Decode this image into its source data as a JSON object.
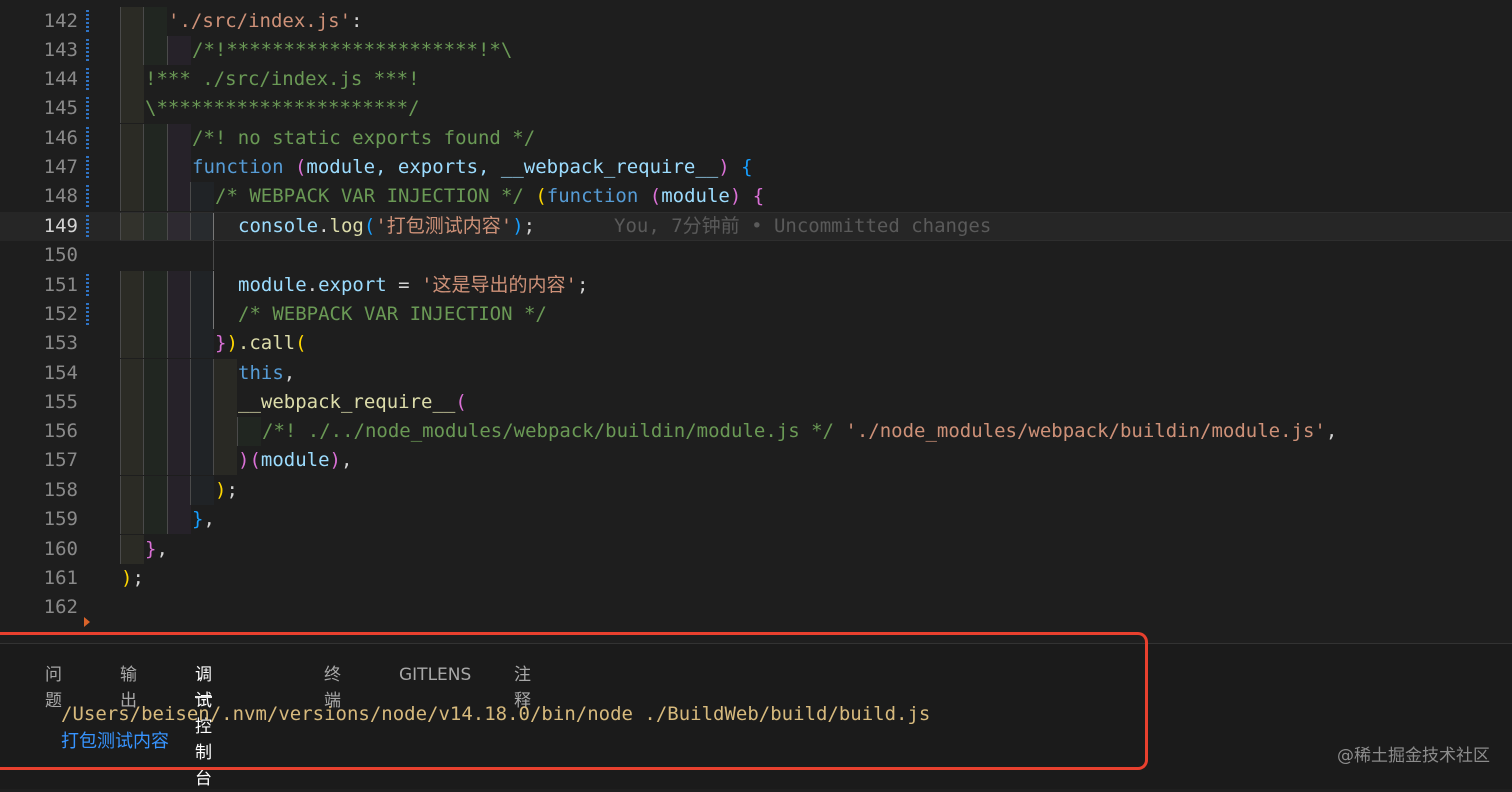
{
  "editor": {
    "lines": [
      {
        "n": "142"
      },
      {
        "n": "143"
      },
      {
        "n": "144"
      },
      {
        "n": "145"
      },
      {
        "n": "146"
      },
      {
        "n": "147"
      },
      {
        "n": "148"
      },
      {
        "n": "149"
      },
      {
        "n": "150"
      },
      {
        "n": "151"
      },
      {
        "n": "152"
      },
      {
        "n": "153"
      },
      {
        "n": "154"
      },
      {
        "n": "155"
      },
      {
        "n": "156"
      },
      {
        "n": "157"
      },
      {
        "n": "158"
      },
      {
        "n": "159"
      },
      {
        "n": "160"
      },
      {
        "n": "161"
      },
      {
        "n": "162"
      }
    ],
    "code": {
      "l142_str": "'./src/index.js'",
      "l142_colon": ":",
      "l143_comment": "/*!**********************!*\\",
      "l144_comment": "!*** ./src/index.js ***!",
      "l145_comment": "\\**********************/",
      "l146_comment": "/*! no static exports found */",
      "l147_function": "function",
      "l147_open": "(",
      "l147_params": "module, exports, __webpack_require__",
      "l147_close": ")",
      "l147_brace": "{",
      "l148_comment": "/* WEBPACK VAR INJECTION */",
      "l148_open": "(",
      "l148_function": "function",
      "l148_popen": "(",
      "l148_param": "module",
      "l148_pclose": ")",
      "l148_brace": "{",
      "l149_obj": "console",
      "l149_dot": ".",
      "l149_fn": "log",
      "l149_open": "(",
      "l149_str": "'打包测试内容'",
      "l149_close": ")",
      "l149_semi": ";",
      "l149_blame": "You, 7分钟前 • Uncommitted changes",
      "l151_obj": "module",
      "l151_dot": ".",
      "l151_prop": "export",
      "l151_eq": " = ",
      "l151_str": "'这是导出的内容'",
      "l151_semi": ";",
      "l152_comment": "/* WEBPACK VAR INJECTION */",
      "l153_brace": "}",
      "l153_paren": ")",
      "l153_call": ".call",
      "l153_open": "(",
      "l154_this": "this",
      "l154_comma": ",",
      "l155_fn": "__webpack_require__",
      "l155_open": "(",
      "l156_comment": "/*! ./../node_modules/webpack/buildin/module.js */",
      "l156_str": "'./node_modules/webpack/buildin/module.js'",
      "l156_comma": ",",
      "l157_close": ")",
      "l157_open": "(",
      "l157_arg": "module",
      "l157_close2": ")",
      "l157_comma": ",",
      "l158_close": ")",
      "l158_semi": ";",
      "l159_brace": "}",
      "l159_comma": ",",
      "l160_brace": "}",
      "l160_comma": ",",
      "l161_close": ")",
      "l161_semi": ";"
    }
  },
  "panel": {
    "tabs": [
      {
        "label": "问题"
      },
      {
        "label": "输出"
      },
      {
        "label": "调试控制台"
      },
      {
        "label": "终端"
      },
      {
        "label": "GITLENS"
      },
      {
        "label": "注释"
      }
    ],
    "active_tab": "调试控制台",
    "output": {
      "command": "/Users/beisen/.nvm/versions/node/v14.18.0/bin/node ./BuildWeb/build/build.js",
      "result": "打包测试内容"
    }
  },
  "colors": {
    "command": "#d7ba7d",
    "result": "#3794ff",
    "highlight_box": "#e8402e"
  },
  "watermark": "@稀土掘金技术社区"
}
